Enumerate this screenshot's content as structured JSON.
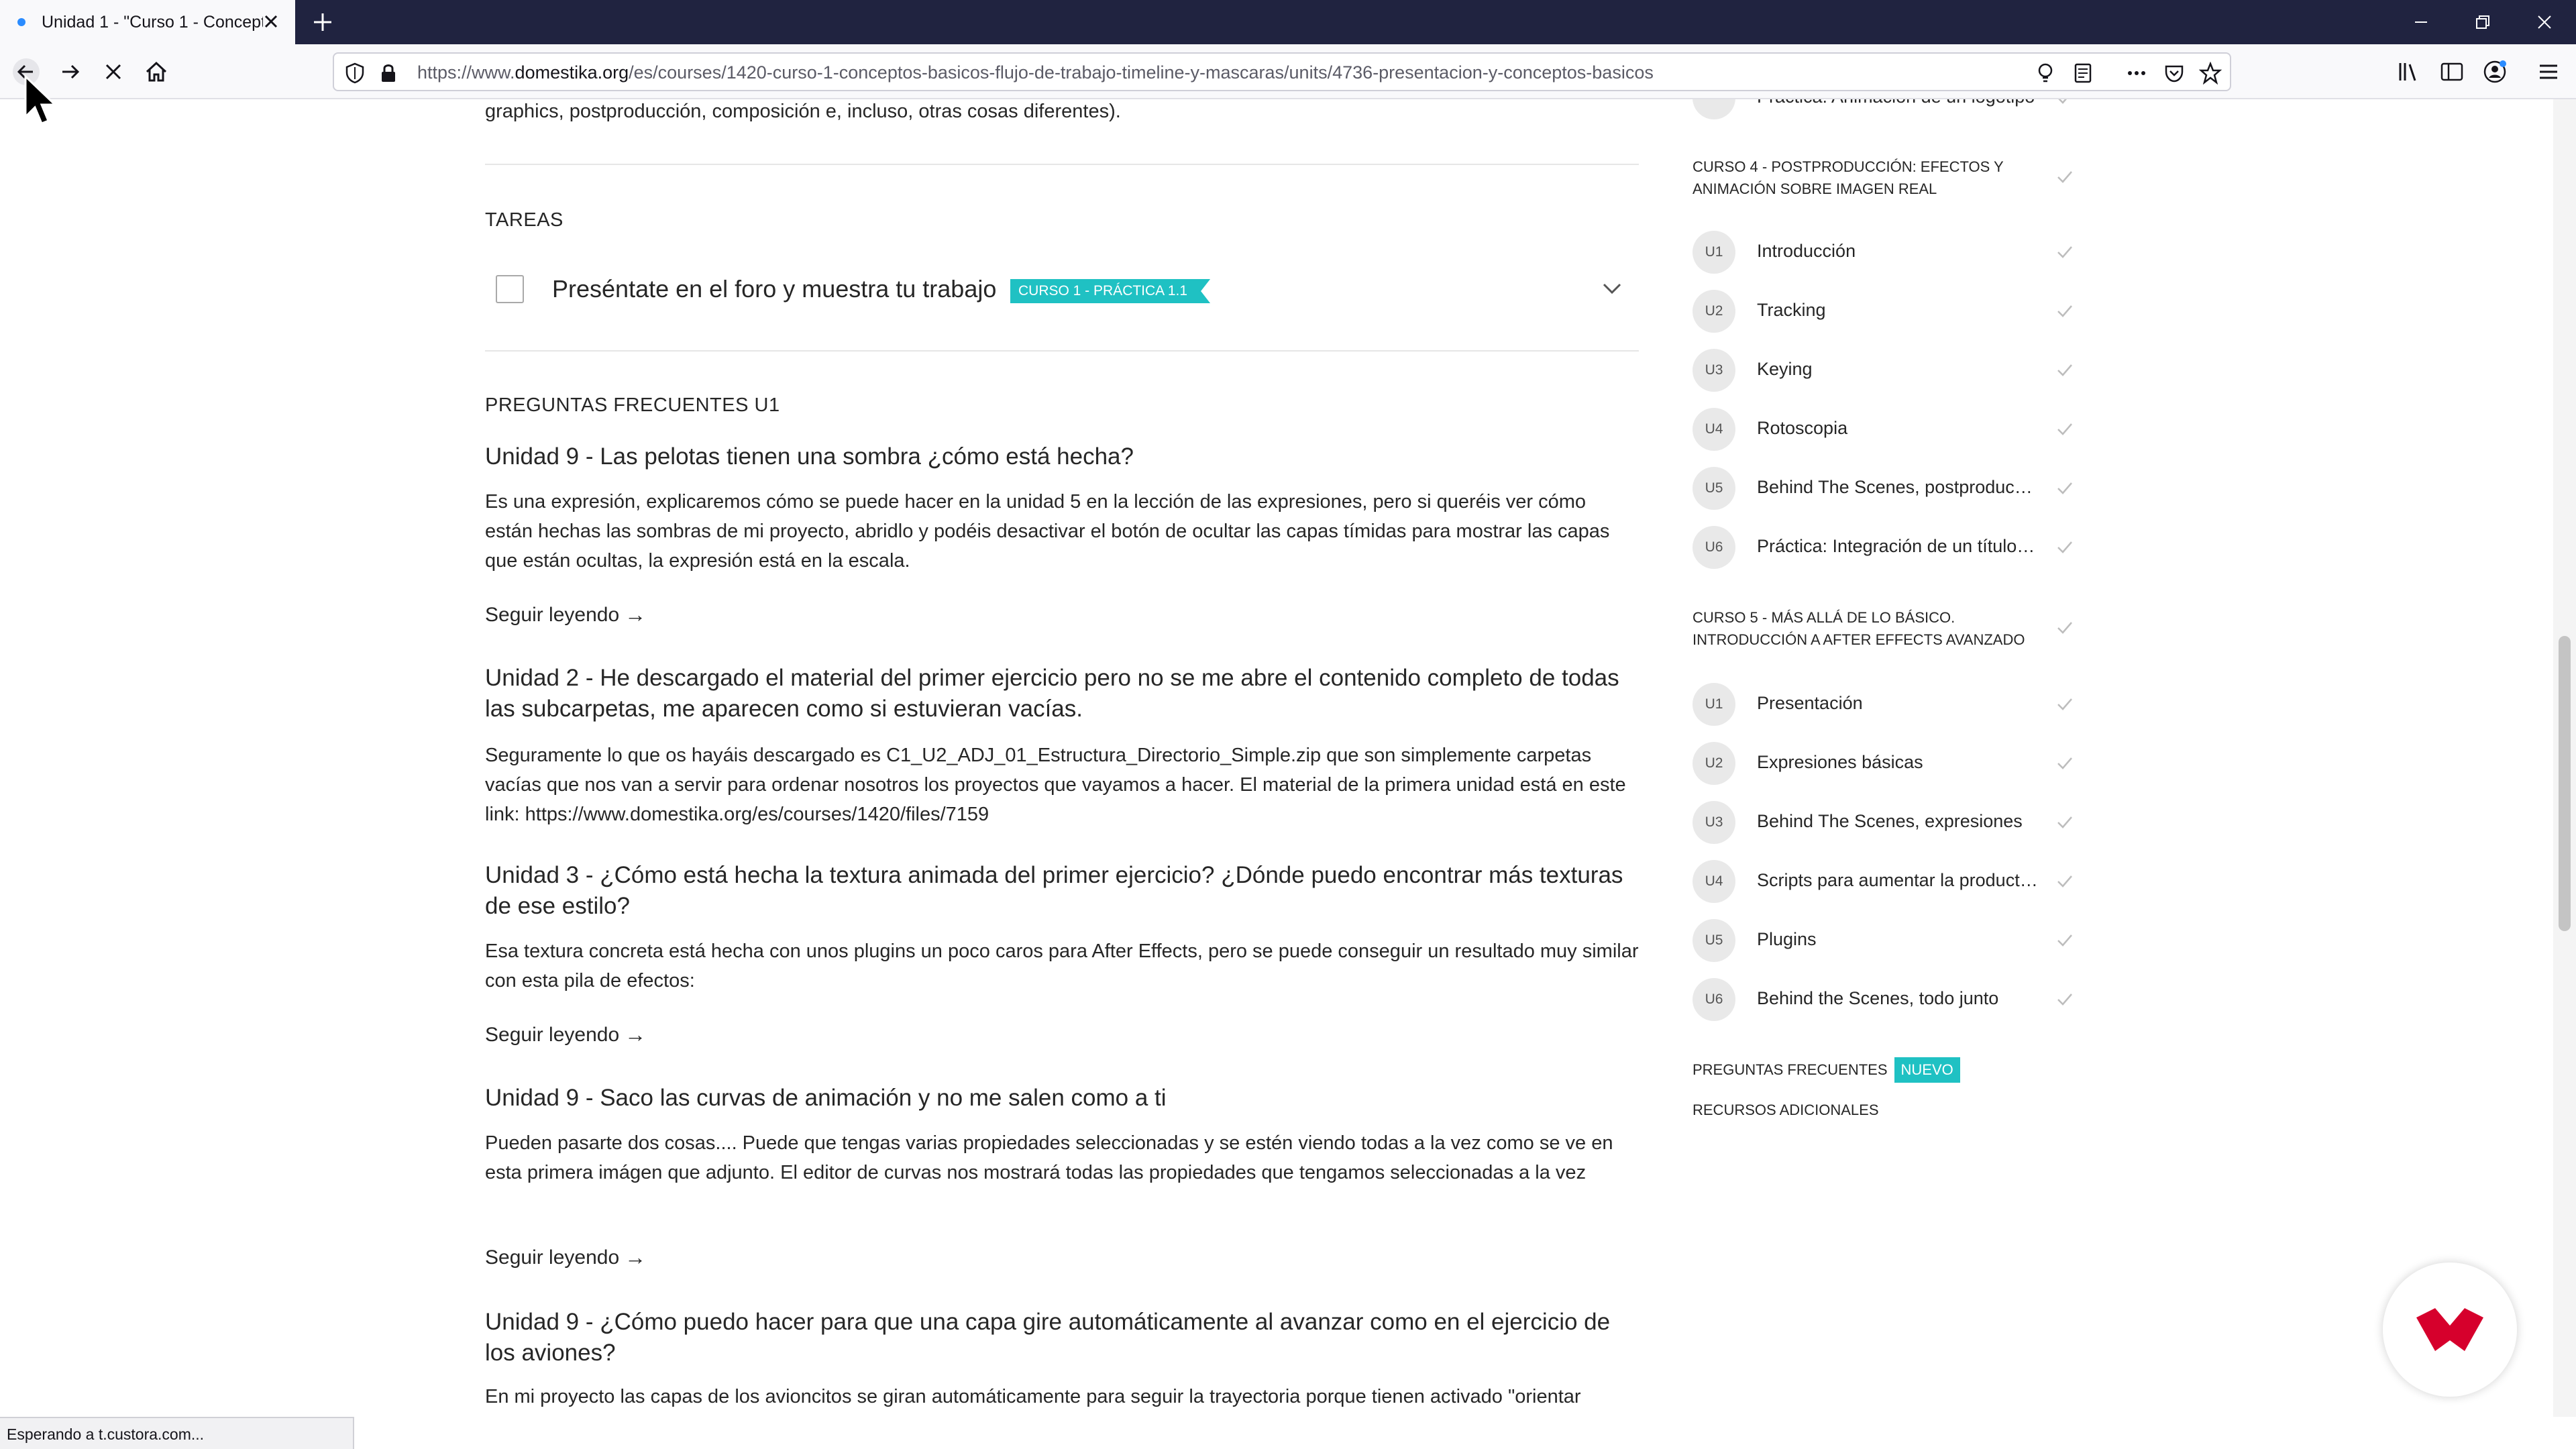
{
  "browser": {
    "tab_title": "Unidad 1 - \"Curso 1 - Concepto",
    "url_prefix": "https://www.",
    "url_domain": "domestika.org",
    "url_path": "/es/courses/1420-curso-1-conceptos-basicos-flujo-de-trabajo-timeline-y-mascaras/units/4736-presentacion-y-conceptos-basicos",
    "status_text": "Esperando a t.custora.com..."
  },
  "main": {
    "intro_tail": "graphics, postproducción, composición e, incluso, otras cosas diferentes).",
    "tasks_title": "TAREAS",
    "task": {
      "label": "Preséntate en el foro y muestra tu trabajo",
      "badge": "CURSO 1 - PRÁCTICA 1.1"
    },
    "faq_title": "PREGUNTAS FRECUENTES U1",
    "read_more": "Seguir leyendo",
    "faqs": [
      {
        "question": "Unidad 9 - Las pelotas tienen una sombra ¿cómo está hecha?",
        "answer": "Es una expresión, explicaremos cómo se puede hacer en la unidad 5 en la lección de las expresiones, pero si queréis ver cómo están hechas las sombras de mi proyecto, abridlo y podéis desactivar el botón de ocultar las capas tímidas para mostrar las capas que están ocultas, la expresión está en la escala."
      },
      {
        "question": "Unidad 2 - He descargado el material del primer ejercicio pero no se me abre el contenido completo de todas las subcarpetas, me aparecen como si estuvieran vacías.",
        "answer": "Seguramente lo que os hayáis descargado es C1_U2_ADJ_01_Estructura_Directorio_Simple.zip que son simplemente carpetas vacías que nos van a servir para ordenar nosotros los proyectos que vayamos a hacer. El material de la primera unidad está en este link: https://www.domestika.org/es/courses/1420/files/7159"
      },
      {
        "question": "Unidad 3 - ¿Cómo está hecha la textura animada del primer ejercicio? ¿Dónde puedo encontrar más texturas de ese estilo?",
        "answer": "Esa textura concreta está hecha con unos plugins un poco caros para After Effects, pero se puede conseguir un resultado muy similar con esta pila de efectos:"
      },
      {
        "question": "Unidad 9 - Saco las curvas de animación y no me salen como a ti",
        "answer": "Pueden pasarte dos cosas.... Puede que tengas varias propiedades seleccionadas y se estén viendo todas a la vez como se ve en esta primera imágen que adjunto. El editor de curvas nos mostrará todas las propiedades que tengamos seleccionadas a la vez"
      },
      {
        "question": "Unidad 9 - ¿Cómo puedo hacer para que una capa gire automáticamente al avanzar como en el ejercicio de los aviones?",
        "answer": "En mi proyecto las capas de los avioncitos se giran automáticamente para seguir la trayectoria porque tienen activado \"orientar automáticamente\". Puedes activarlo en Layer/Transform/Auto-Orient o pulsando Ctrl+Alt+O en PC o Cmd+Opt+O en Mac"
      }
    ]
  },
  "sidebar": {
    "partial_item": "Práctica: Animación de un logotipo",
    "course4": {
      "title": "CURSO 4 - POSTPRODUCCIÓN: EFECTOS Y ANIMACIÓN SOBRE IMAGEN REAL",
      "units": [
        {
          "num": "U1",
          "label": "Introducción"
        },
        {
          "num": "U2",
          "label": "Tracking"
        },
        {
          "num": "U3",
          "label": "Keying"
        },
        {
          "num": "U4",
          "label": "Rotoscopia"
        },
        {
          "num": "U5",
          "label": "Behind The Scenes, postproducción"
        },
        {
          "num": "U6",
          "label": "Práctica: Integración de un título en imagen real"
        }
      ]
    },
    "course5": {
      "title": "CURSO 5 - MÁS ALLÁ DE LO BÁSICO. INTRODUCCIÓN A AFTER EFFECTS AVANZADO",
      "units": [
        {
          "num": "U1",
          "label": "Presentación"
        },
        {
          "num": "U2",
          "label": "Expresiones básicas"
        },
        {
          "num": "U3",
          "label": "Behind The Scenes, expresiones"
        },
        {
          "num": "U4",
          "label": "Scripts para aumentar la productividad"
        },
        {
          "num": "U5",
          "label": "Plugins"
        },
        {
          "num": "U6",
          "label": "Behind the Scenes, todo junto"
        }
      ]
    },
    "faq_link": "PREGUNTAS FRECUENTES",
    "new_badge": "NUEVO",
    "resources_link": "RECURSOS ADICIONALES"
  },
  "colors": {
    "tabbar": "#202340",
    "accent": "#1fc1c3",
    "brand_red": "#d6002c"
  },
  "icons": [
    "back-arrow-icon",
    "forward-arrow-icon",
    "stop-icon",
    "home-icon",
    "shield-icon",
    "lock-icon",
    "lightbulb-icon",
    "reader-view-icon",
    "more-icon",
    "pocket-icon",
    "bookmark-star-icon",
    "library-icon",
    "sidebar-icon",
    "account-icon",
    "hamburger-menu-icon",
    "check-icon",
    "chevron-down-icon",
    "domestika-logo-icon"
  ]
}
